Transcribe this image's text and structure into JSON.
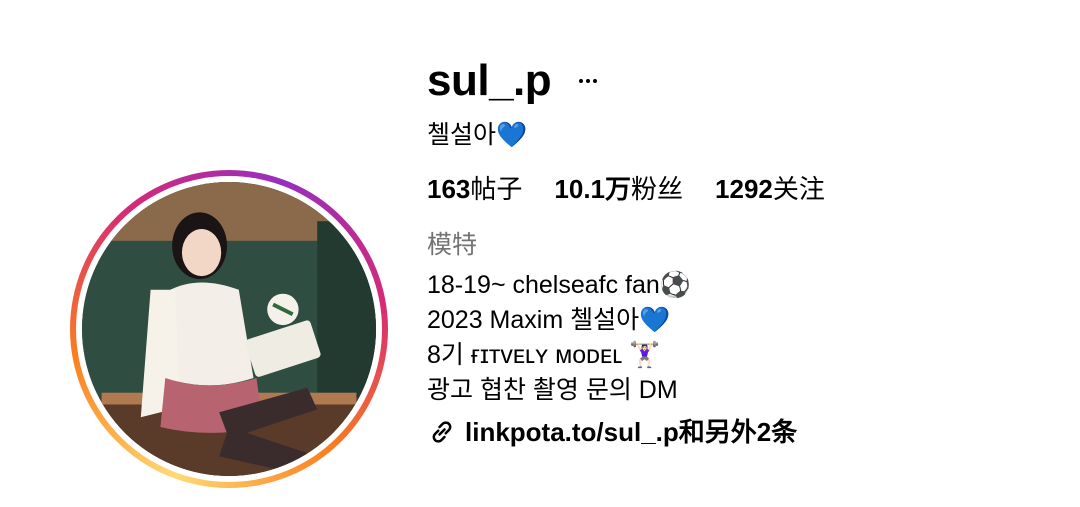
{
  "profile": {
    "username": "sul_.p",
    "display_name": "첼설아💙",
    "category": "模特",
    "stats": [
      {
        "count": "163",
        "label": "帖子"
      },
      {
        "count": "10.1万",
        "label": "粉丝"
      },
      {
        "count": "1292",
        "label": "关注"
      }
    ],
    "bio_lines": [
      "18-19~ chelseafc fan⚽",
      "2023 Maxim 첼설아💙",
      "8기 ғɪᴛᴠᴇʟʏ ᴍᴏᴅᴇʟ 🏋🏻‍♀️",
      "광고 협찬 촬영 문의 DM"
    ],
    "link_text": "linkpota.to/sul_.p和另外2条"
  },
  "icons": {
    "more": "more-horizontal-icon",
    "link": "link-chain-icon"
  },
  "colors": {
    "ring_start": "#feda75",
    "ring_mid": "#d62976",
    "ring_end": "#962fbf",
    "secondary_text": "#737373"
  }
}
